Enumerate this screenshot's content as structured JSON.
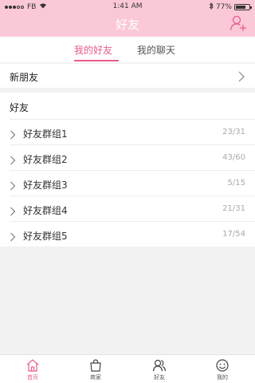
{
  "status_bar": {
    "carrier": "FB",
    "time": "1:41 AM",
    "battery": "77%",
    "battery_level": 0.77,
    "icons": [
      "signal-icon",
      "wifi-icon",
      "bluetooth-icon",
      "battery-icon"
    ]
  },
  "header": {
    "title": "好友",
    "add_icon": "add-friend-icon"
  },
  "tabs": [
    {
      "label": "我的好友",
      "active": true
    },
    {
      "label": "我的聊天",
      "active": false
    }
  ],
  "new_friends": {
    "label": "新朋友"
  },
  "friends": {
    "title": "好友",
    "groups": [
      {
        "name": "好友群组1",
        "count": "23/31"
      },
      {
        "name": "好友群组2",
        "count": "43/60"
      },
      {
        "name": "好友群组3",
        "count": "5/15"
      },
      {
        "name": "好友群组4",
        "count": "21/31"
      },
      {
        "name": "好友群组5",
        "count": "17/54"
      }
    ]
  },
  "tab_bar": {
    "items": [
      {
        "label": "首页",
        "icon": "home-icon",
        "active": true
      },
      {
        "label": "商家",
        "icon": "shopping-bag-icon",
        "active": false
      },
      {
        "label": "好友",
        "icon": "friends-icon",
        "active": false
      },
      {
        "label": "我的",
        "icon": "smiley-icon",
        "active": false
      }
    ]
  },
  "colors": {
    "header_bg": "#fbc8d7",
    "accent": "#ea5a8f",
    "page_bg": "#f2f2f2"
  }
}
